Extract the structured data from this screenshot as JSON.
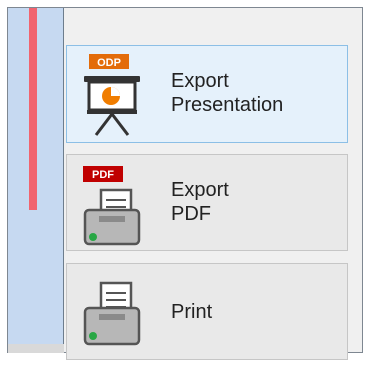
{
  "buttons": [
    {
      "name": "export-presentation-button",
      "badge": "ODP",
      "lines": [
        "Export",
        "Presentation"
      ],
      "selected": true
    },
    {
      "name": "export-pdf-button",
      "badge": "PDF",
      "lines": [
        "Export",
        "PDF"
      ],
      "selected": false
    },
    {
      "name": "print-button",
      "badge": "",
      "lines": [
        "Print"
      ],
      "selected": false
    }
  ],
  "colors": {
    "odp_badge": "#e36c0a",
    "pdf_badge": "#c00000",
    "chart_orange": "#f07d00",
    "printer_led": "#28a745",
    "selected_bg": "#e5f1fb",
    "selected_border": "#8cbfe6"
  },
  "icons": [
    "presentation-board-icon",
    "pdf-printer-icon",
    "printer-icon"
  ]
}
